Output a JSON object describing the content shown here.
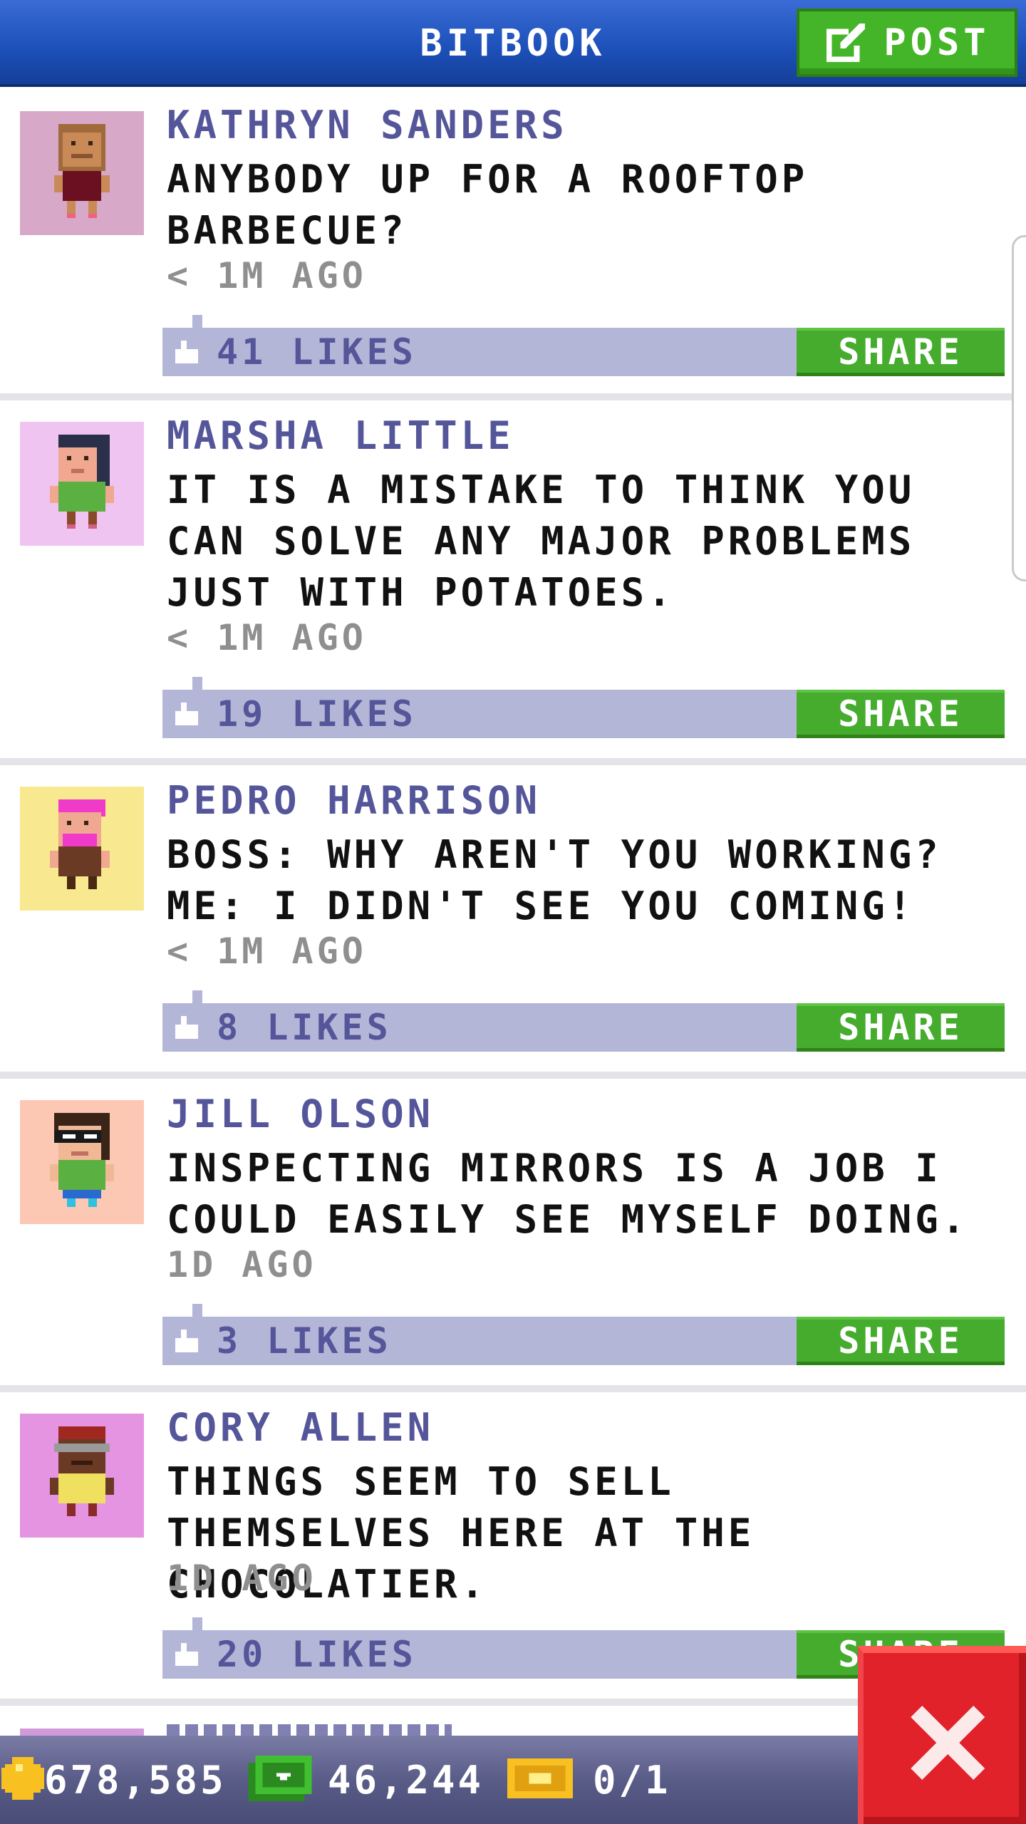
{
  "header": {
    "title": "BITBOOK",
    "post_label": "POST"
  },
  "posts": [
    {
      "author": "KATHRYN SANDERS",
      "message": "ANYBODY UP FOR A ROOFTOP BARBECUE?",
      "time": "< 1M AGO",
      "likes": "41 LIKES",
      "share_label": "SHARE",
      "avatar_bg": "#d8a8c8"
    },
    {
      "author": "MARSHA LITTLE",
      "message": "IT IS A MISTAKE TO THINK YOU CAN SOLVE ANY MAJOR PROBLEMS JUST WITH POTATOES.",
      "time": "< 1M AGO",
      "likes": "19 LIKES",
      "share_label": "SHARE",
      "avatar_bg": "#f0c4f0"
    },
    {
      "author": "PEDRO HARRISON",
      "message": "BOSS: WHY AREN'T YOU WORKING? ME: I DIDN'T SEE YOU COMING!",
      "time": "< 1M AGO",
      "likes": "8 LIKES",
      "share_label": "SHARE",
      "avatar_bg": "#f8e890"
    },
    {
      "author": "JILL OLSON",
      "message": "INSPECTING MIRRORS IS A JOB I COULD EASILY SEE MYSELF DOING.",
      "time": "1D AGO",
      "likes": "3 LIKES",
      "share_label": "SHARE",
      "avatar_bg": "#fcc8b4"
    },
    {
      "author": "CORY ALLEN",
      "message": "THINGS SEEM TO SELL THEMSELVES HERE AT THE CHOCOLATIER.",
      "time": "1D AGO",
      "likes": "20 LIKES",
      "share_label": "SHARE",
      "avatar_bg": "#e494e0"
    }
  ],
  "status": {
    "coins": "678,585",
    "bux": "46,244",
    "tickets": "0/1"
  },
  "icons": {
    "post": "edit-icon",
    "like": "thumbs-up-icon",
    "coin": "coin-icon",
    "bux": "bitbux-icon",
    "ticket": "ticket-icon",
    "close": "close-icon"
  },
  "colors": {
    "header_blue": "#1c4fb7",
    "post_green": "#44b528",
    "share_green": "#45ac2e",
    "like_bar": "#b4b6d8",
    "name_purple": "#55569a",
    "close_red": "#e2222a"
  }
}
